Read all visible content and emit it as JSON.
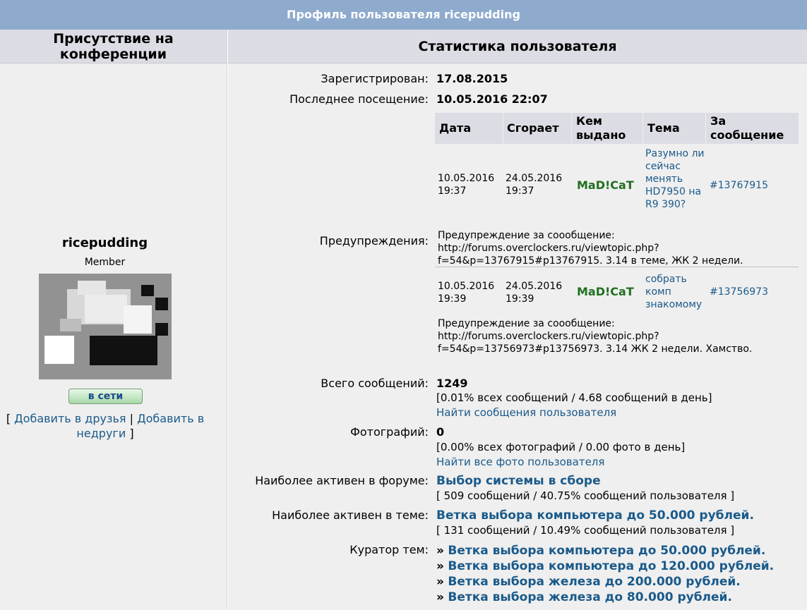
{
  "title": "Профиль пользователя ricepudding",
  "left": {
    "header": "Присутствие на конференции",
    "username": "ricepudding",
    "rank": "Member",
    "avatar_icon": "avatar-image",
    "online_label": "в сети",
    "bracket_open": "[",
    "add_friend": "Добавить в друзья",
    "divider": "|",
    "add_foe": "Добавить в недруги",
    "bracket_close": "]"
  },
  "right": {
    "header": "Статистика пользователя",
    "registered_label": "Зарегистрирован:",
    "registered_value": "17.08.2015",
    "last_visit_label": "Последнее посещение:",
    "last_visit_value": "10.05.2016 22:07",
    "warnings_label": "Предупреждения:",
    "warnings_table": {
      "headers": [
        "Дата",
        "Сгорает",
        "Кем выдано",
        "Тема",
        "За сообщение"
      ],
      "rows": [
        {
          "date": "10.05.2016 19:37",
          "expires": "24.05.2016 19:37",
          "issued_by": "MaD!CaT",
          "topic": "Разумно ли сейчас менять HD7950 на R9 390?",
          "post": "#13767915",
          "reason": "Предупреждение за соообщение: http://forums.overclockers.ru/viewtopic.php?f=54&p=13767915#p13767915. 3.14 в теме, ЖК 2 недели."
        },
        {
          "date": "10.05.2016 19:39",
          "expires": "24.05.2016 19:39",
          "issued_by": "MaD!CaT",
          "topic": "собрать комп знакомому",
          "post": "#13756973",
          "reason": "Предупреждение за соообщение: http://forums.overclockers.ru/viewtopic.php?f=54&p=13756973#p13756973. 3.14 ЖК 2 недели. Хамство."
        }
      ]
    },
    "total_posts_label": "Всего сообщений:",
    "total_posts_value": "1249",
    "total_posts_stats": "[0.01% всех сообщений / 4.68 сообщений в день]",
    "find_posts_link": "Найти сообщения пользователя",
    "photos_label": "Фотографий:",
    "photos_value": "0",
    "photos_stats": "[0.00% всех фотографий / 0.00 фото в день]",
    "find_photos_link": "Найти все фото пользователя",
    "active_forum_label": "Наиболее активен в форуме:",
    "active_forum_value": "Выбор системы в сборе",
    "active_forum_stats": "[ 509 сообщений / 40.75% сообщений пользователя ]",
    "active_topic_label": "Наиболее активен в теме:",
    "active_topic_value": "Ветка выбора компьютера до 50.000 рублей.",
    "active_topic_stats": "[ 131 сообщений / 10.49% сообщений пользователя ]",
    "curator_label": "Куратор тем:",
    "curator_bullet": "»",
    "curator_topics": [
      "Ветка выбора компьютера до 50.000 рублей.",
      "Ветка выбора компьютера до 120.000 рублей.",
      "Ветка выбора железа до 200.000 рублей.",
      "Ветка выбора железа до 80.000 рублей."
    ]
  },
  "colors": {
    "title_bar": "#8eaacd",
    "header_bg": "#dcdce4",
    "panel_bg": "#efefef",
    "link": "#1a5a8a",
    "moderator": "#207020"
  }
}
